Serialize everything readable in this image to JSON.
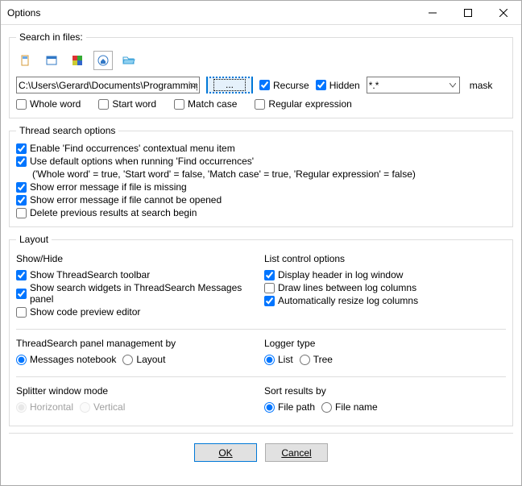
{
  "window": {
    "title": "Options"
  },
  "searchInFiles": {
    "legend": "Search in files:",
    "path": "C:\\Users\\Gerard\\Documents\\Programming",
    "browse": "...",
    "recurse": "Recurse",
    "hidden": "Hidden",
    "mask": "*.*",
    "maskLabel": "mask",
    "wholeWord": "Whole word",
    "startWord": "Start word",
    "matchCase": "Match case",
    "regex": "Regular expression"
  },
  "threadOptions": {
    "legend": "Thread search options",
    "enableFindOccurrences": "Enable 'Find occurrences' contextual menu item",
    "useDefault": "Use default options when running 'Find occurrences'",
    "useDefaultHint": "('Whole word' = true, 'Start word' = false, 'Match case' = true, 'Regular expression' = false)",
    "errMissing": "Show error message if file is missing",
    "errOpen": "Show error message if file cannot be opened",
    "deletePrev": "Delete previous results at search begin"
  },
  "layout": {
    "legend": "Layout",
    "showHide": {
      "legend": "Show/Hide",
      "toolbar": "Show ThreadSearch toolbar",
      "widgets": "Show search widgets in ThreadSearch Messages panel",
      "preview": "Show code preview editor"
    },
    "listControl": {
      "legend": "List control options",
      "header": "Display header in log window",
      "lines": "Draw lines between log columns",
      "autoResize": "Automatically resize log columns"
    },
    "panelMgmt": {
      "legend": "ThreadSearch panel management by",
      "messages": "Messages notebook",
      "layout": "Layout"
    },
    "logger": {
      "legend": "Logger type",
      "list": "List",
      "tree": "Tree"
    },
    "splitter": {
      "legend": "Splitter window mode",
      "horizontal": "Horizontal",
      "vertical": "Vertical"
    },
    "sort": {
      "legend": "Sort results by",
      "path": "File path",
      "name": "File name"
    }
  },
  "buttons": {
    "ok": "OK",
    "cancel": "Cancel"
  }
}
